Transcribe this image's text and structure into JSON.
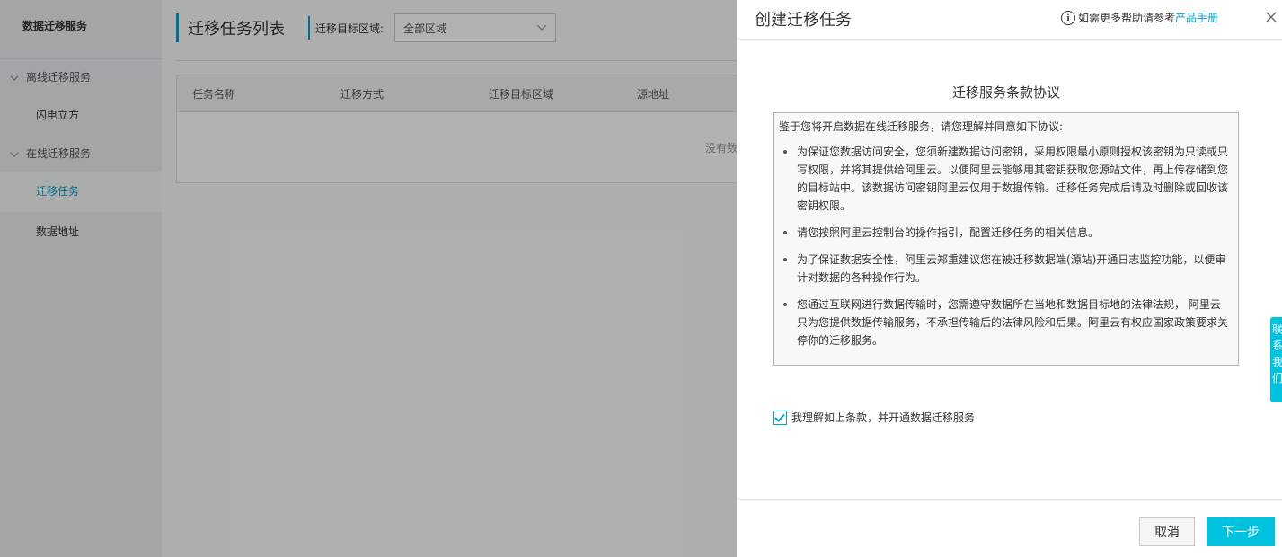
{
  "sidebar": {
    "title": "数据迁移服务",
    "groups": [
      {
        "label": "离线迁移服务",
        "items": [
          {
            "label": "闪电立方",
            "active": false
          }
        ]
      },
      {
        "label": "在线迁移服务",
        "items": [
          {
            "label": "迁移任务",
            "active": true
          },
          {
            "label": "数据地址",
            "active": false
          }
        ]
      }
    ]
  },
  "main": {
    "title": "迁移任务列表",
    "region_label": "迁移目标区域:",
    "region_value": "全部区域",
    "table": {
      "columns": [
        "任务名称",
        "迁移方式",
        "迁移目标区域",
        "源地址"
      ],
      "empty_text": "没有数"
    }
  },
  "drawer": {
    "title": "创建迁移任务",
    "help_text": "如需更多帮助请参考",
    "help_link": "产品手册",
    "terms_title": "迁移服务条款协议",
    "terms_intro": "鉴于您将开启数据在线迁移服务，请您理解并同意如下协议:",
    "terms_items": [
      "为保证您数据访问安全，您须新建数据访问密钥，采用权限最小原则授权该密钥为只读或只写权限，并将其提供给阿里云。以便阿里云能够用其密钥获取您源站文件，再上传存储到您的目标站中。该数据访问密钥阿里云仅用于数据传输。迁移任务完成后请及时删除或回收该密钥权限。",
      "请您按照阿里云控制台的操作指引，配置迁移任务的相关信息。",
      "为了保证数据安全性，阿里云郑重建议您在被迁移数据端(源站)开通日志监控功能，以便审计对数据的各种操作行为。",
      "您通过互联网进行数据传输时，您需遵守数据所在当地和数据目标地的法律法规， 阿里云只为您提供数据传输服务，不承担传输后的法律风险和后果。阿里云有权应国家政策要求关停你的迁移服务。"
    ],
    "agree_label": "我理解如上条款，并开通数据迁移服务",
    "agree_checked": true,
    "cancel_label": "取消",
    "next_label": "下一步"
  },
  "side_tab": {
    "chars": [
      "联",
      "系",
      "我",
      "们"
    ]
  },
  "colors": {
    "accent": "#00c1de",
    "link": "#00a2ca"
  }
}
